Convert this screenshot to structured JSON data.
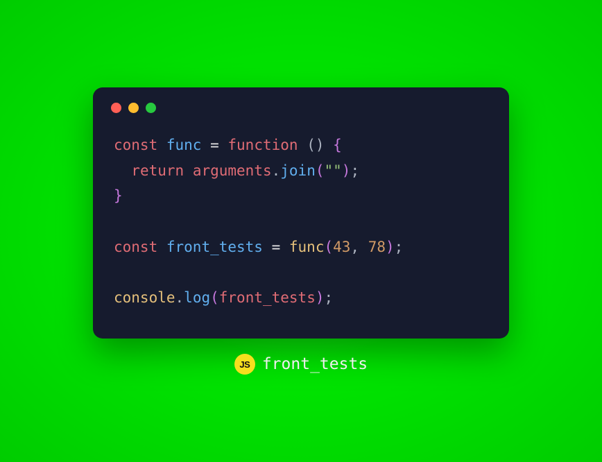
{
  "colors": {
    "background_green": "#00e600",
    "editor_bg": "#161b2e",
    "traffic_close": "#ff5f56",
    "traffic_min": "#ffbd2e",
    "traffic_max": "#27c93f",
    "js_badge": "#f7df1e"
  },
  "code": {
    "line1": {
      "kw_const": "const",
      "name": "func",
      "eq": " = ",
      "kw_function": "function",
      "parens": " () ",
      "brace_open": "{"
    },
    "line2": {
      "indent": "  ",
      "kw_return": "return",
      "space": " ",
      "arguments": "arguments",
      "dot": ".",
      "join": "join",
      "open": "(",
      "str": "\"\"",
      "close": ")",
      "semi": ";"
    },
    "line3": {
      "brace_close": "}"
    },
    "line5": {
      "kw_const": "const",
      "name": "front_tests",
      "eq": " = ",
      "call": "func",
      "open": "(",
      "arg1": "43",
      "comma": ", ",
      "arg2": "78",
      "close": ")",
      "semi": ";"
    },
    "line7": {
      "console": "console",
      "dot": ".",
      "log": "log",
      "open": "(",
      "arg": "front_tests",
      "close": ")",
      "semi": ";"
    }
  },
  "footer": {
    "badge_text": "JS",
    "filename": "front_tests"
  }
}
